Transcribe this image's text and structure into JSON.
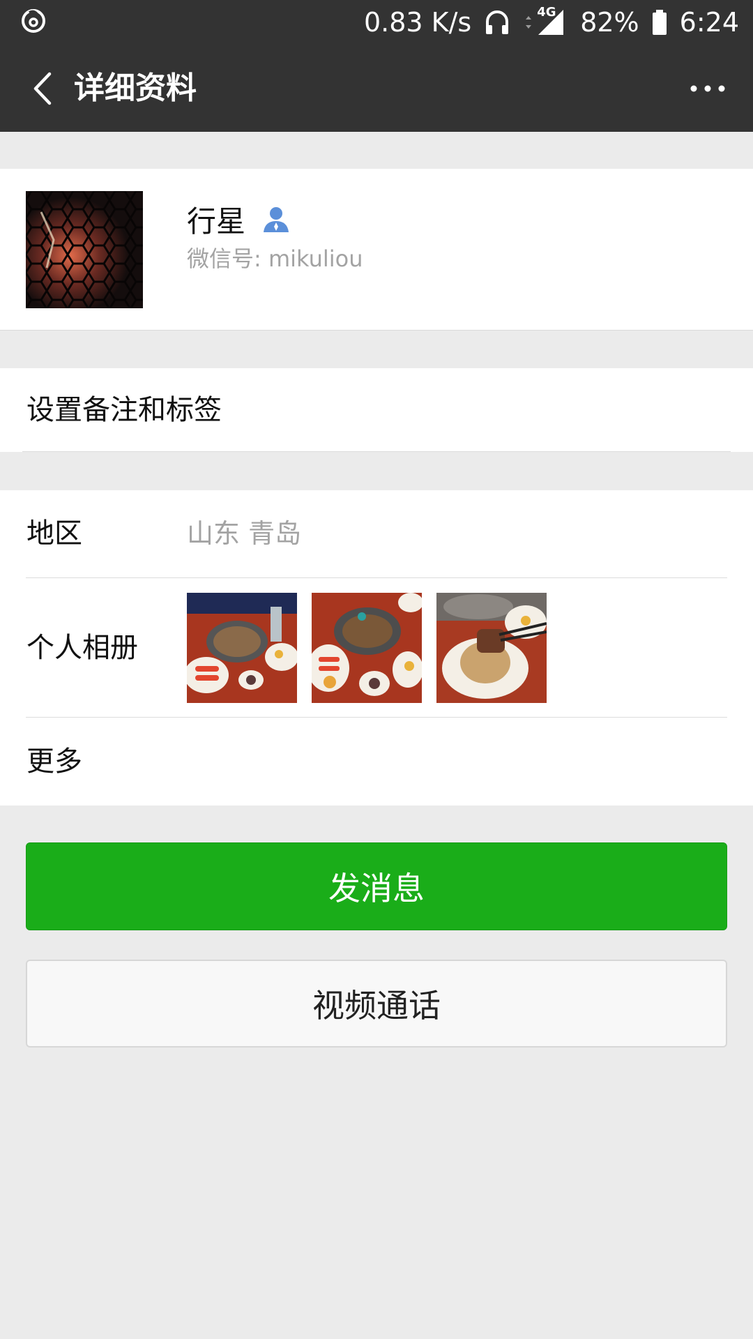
{
  "status_bar": {
    "speed": "0.83 K/s",
    "network": "4G",
    "battery": "82%",
    "time": "6:24",
    "icons": [
      "netease-music-icon",
      "headphones-icon",
      "data-arrows-icon",
      "signal-icon",
      "battery-icon"
    ]
  },
  "header": {
    "title": "详细资料",
    "back_icon": "chevron-left-icon",
    "more_icon": "more-dots-icon"
  },
  "profile": {
    "name": "行星",
    "wechat_id": "微信号: mikuliou",
    "contact_icon": "contact-person-icon"
  },
  "remark": {
    "label": "设置备注和标签"
  },
  "info": {
    "region_label": "地区",
    "region_value": "山东 青岛",
    "album_label": "个人相册",
    "more_label": "更多"
  },
  "actions": {
    "send_message": "发消息",
    "video_call": "视频通话"
  },
  "colors": {
    "bar_bg": "#333333",
    "primary_green": "#1aad19",
    "page_bg": "#ebebeb"
  }
}
